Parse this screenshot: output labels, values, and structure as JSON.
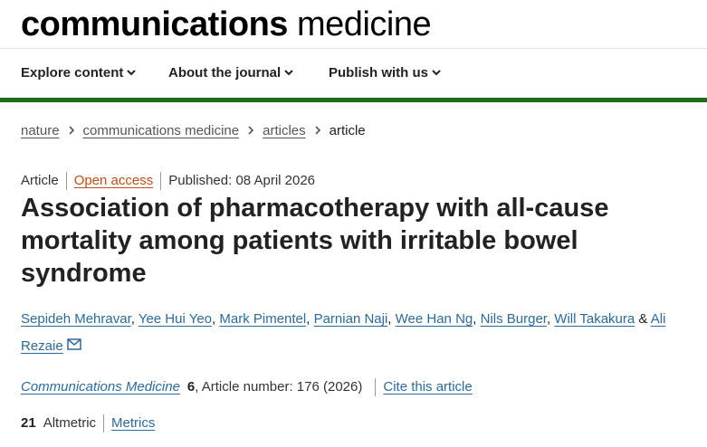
{
  "header": {
    "logo_bold": "communications",
    "logo_light": "medicine"
  },
  "nav": {
    "items": [
      {
        "label": "Explore content"
      },
      {
        "label": "About the journal"
      },
      {
        "label": "Publish with us"
      }
    ]
  },
  "breadcrumb": {
    "items": [
      "nature",
      "communications medicine",
      "articles"
    ],
    "current": "article"
  },
  "article": {
    "type": "Article",
    "access": "Open access",
    "published": "Published: 08 April 2026",
    "title": "Association of pharmacotherapy with all-cause mortality among patients with irritable bowel syndrome",
    "authors": [
      "Sepideh Mehravar",
      "Yee Hui Yeo",
      "Mark Pimentel",
      "Parnian Naji",
      "Wee Han Ng",
      "Nils Burger",
      "Will Takakura"
    ],
    "author_sep": ",",
    "last_author_joiner": "&",
    "last_author_first": "Ali",
    "last_author_last": "Rezaie",
    "journal": "Communications Medicine",
    "volume": "6",
    "article_number": ", Article number: 176 (2026)",
    "cite_label": "Cite this article",
    "altmetric_count": "21",
    "altmetric_label": "Altmetric",
    "metrics_label": "Metrics"
  },
  "colors": {
    "accent_green": "#1a6e1a",
    "link_blue": "#2a6a9c",
    "open_access_orange": "#c54c14"
  }
}
